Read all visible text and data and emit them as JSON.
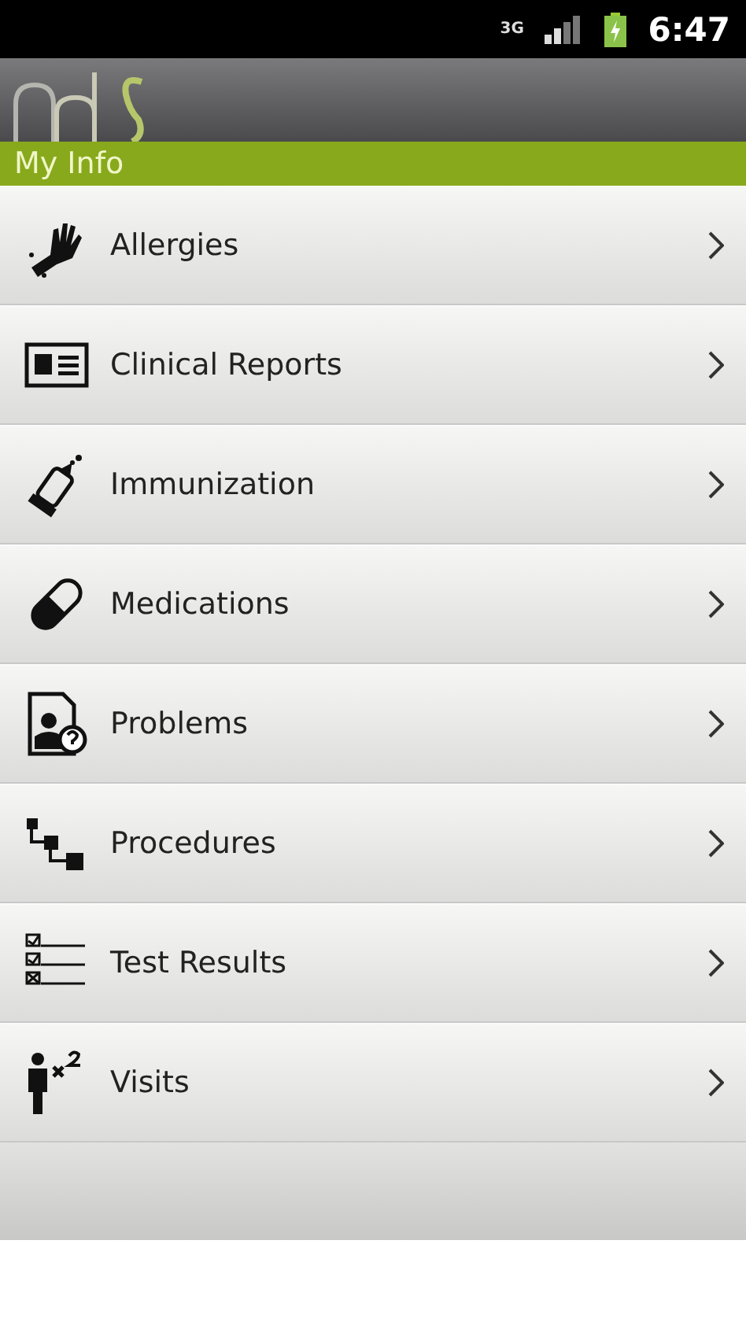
{
  "status_bar": {
    "network": "3G",
    "time": "6:47"
  },
  "section_title": "My Info",
  "items": [
    {
      "kind": "glove",
      "label": "Allergies"
    },
    {
      "kind": "report",
      "label": "Clinical Reports"
    },
    {
      "kind": "syringe",
      "label": "Immunization"
    },
    {
      "kind": "pill",
      "label": "Medications"
    },
    {
      "kind": "problem",
      "label": "Problems"
    },
    {
      "kind": "steps",
      "label": "Procedures"
    },
    {
      "kind": "checklist",
      "label": "Test Results"
    },
    {
      "kind": "person",
      "label": "Visits"
    }
  ]
}
